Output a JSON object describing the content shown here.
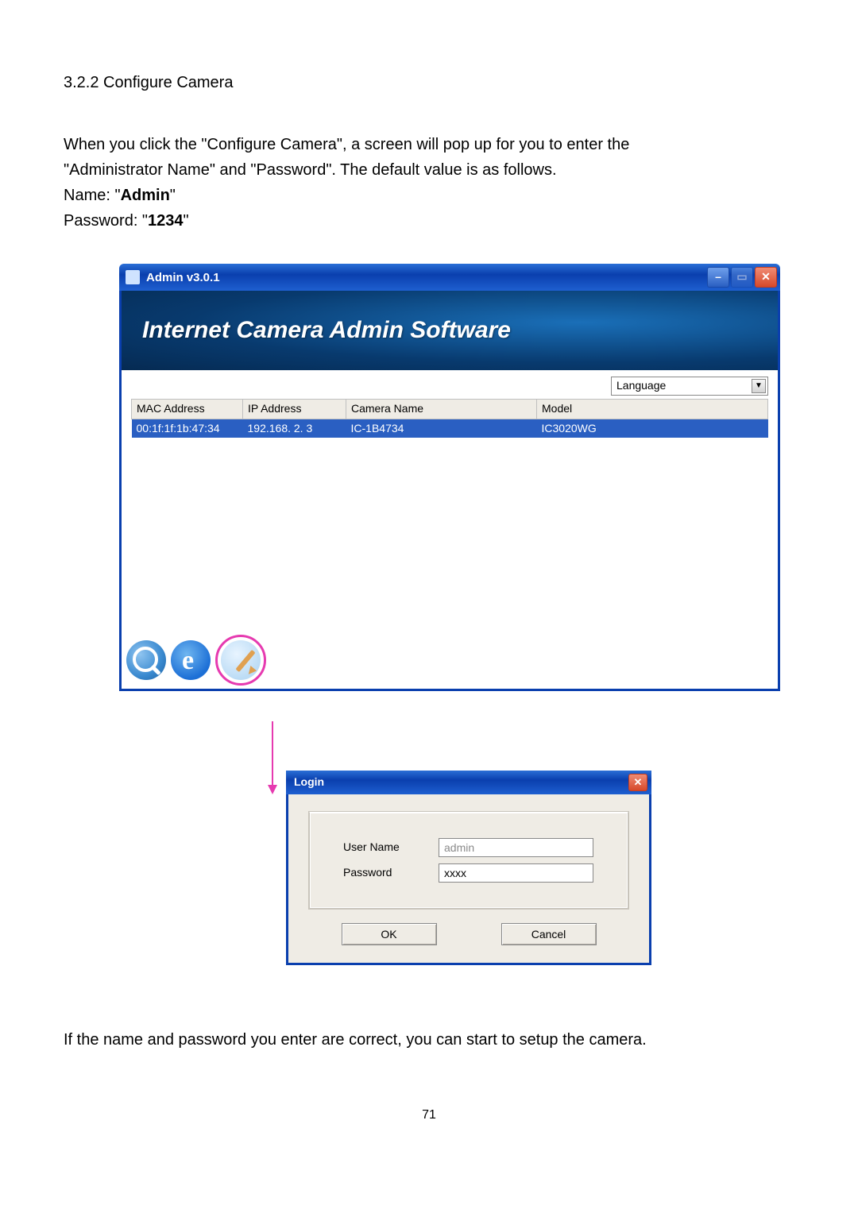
{
  "section_heading": "3.2.2 Configure Camera",
  "intro_line1": "When you click the \"Configure Camera\", a screen will pop up for you to enter the",
  "intro_line2": "\"Administrator Name\" and \"Password\". The default value is as follows.",
  "name_label_pre": "Name: \"",
  "name_default": "Admin",
  "name_label_post": "\"",
  "pass_label_pre": "Password: \"",
  "pass_default": "1234",
  "pass_label_post": "\"",
  "admin_window": {
    "title": "Admin v3.0.1",
    "banner": "Internet Camera Admin Software",
    "language_label": "Language",
    "table": {
      "headers": {
        "mac": "MAC Address",
        "ip": "IP Address",
        "name": "Camera Name",
        "model": "Model"
      },
      "row": {
        "mac": "00:1f:1f:1b:47:34",
        "ip": "192.168.  2.  3",
        "name": "IC-1B4734",
        "model": "IC3020WG"
      }
    }
  },
  "login": {
    "title": "Login",
    "user_label": "User Name",
    "user_value": "admin",
    "pass_label": "Password",
    "pass_value": "xxxx",
    "ok": "OK",
    "cancel": "Cancel"
  },
  "after_text": "If the name and password you enter are correct, you can start to setup the camera.",
  "page_number": "71"
}
